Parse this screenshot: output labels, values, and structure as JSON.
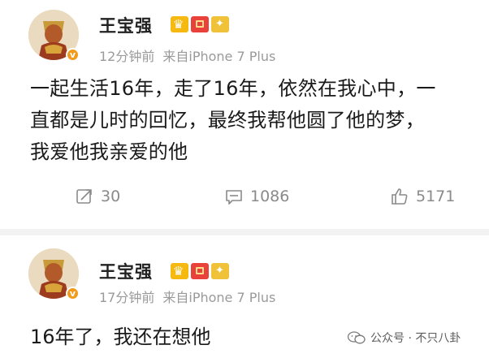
{
  "posts": [
    {
      "user": {
        "name": "王宝强"
      },
      "meta": {
        "time": "12分钟前",
        "source": "来自iPhone 7 Plus"
      },
      "text_lines": [
        "一起生活16年，走了16年，依然在我心中，一",
        "直都是儿时的回忆，最终我帮他圆了他的梦，",
        "我爱他我亲爱的他"
      ],
      "actions": {
        "repost": "30",
        "comment": "1086",
        "like": "5171"
      }
    },
    {
      "user": {
        "name": "王宝强"
      },
      "meta": {
        "time": "17分钟前",
        "source": "来自iPhone 7 Plus"
      },
      "text": "16年了，我还在想他"
    }
  ],
  "watermark": {
    "text": "公众号 · 不只八卦"
  },
  "icons": [
    "avatar-image",
    "verified-icon",
    "crown-badge-icon",
    "red-envelope-badge-icon",
    "gold-badge-icon",
    "repost-icon",
    "comment-icon",
    "like-icon",
    "wechat-logo-icon"
  ],
  "colors": {
    "background": "#f2f2f2",
    "card": "#ffffff",
    "text": "#1a1a1a",
    "meta": "#9a9a9a",
    "verified": "#f29a1a"
  }
}
